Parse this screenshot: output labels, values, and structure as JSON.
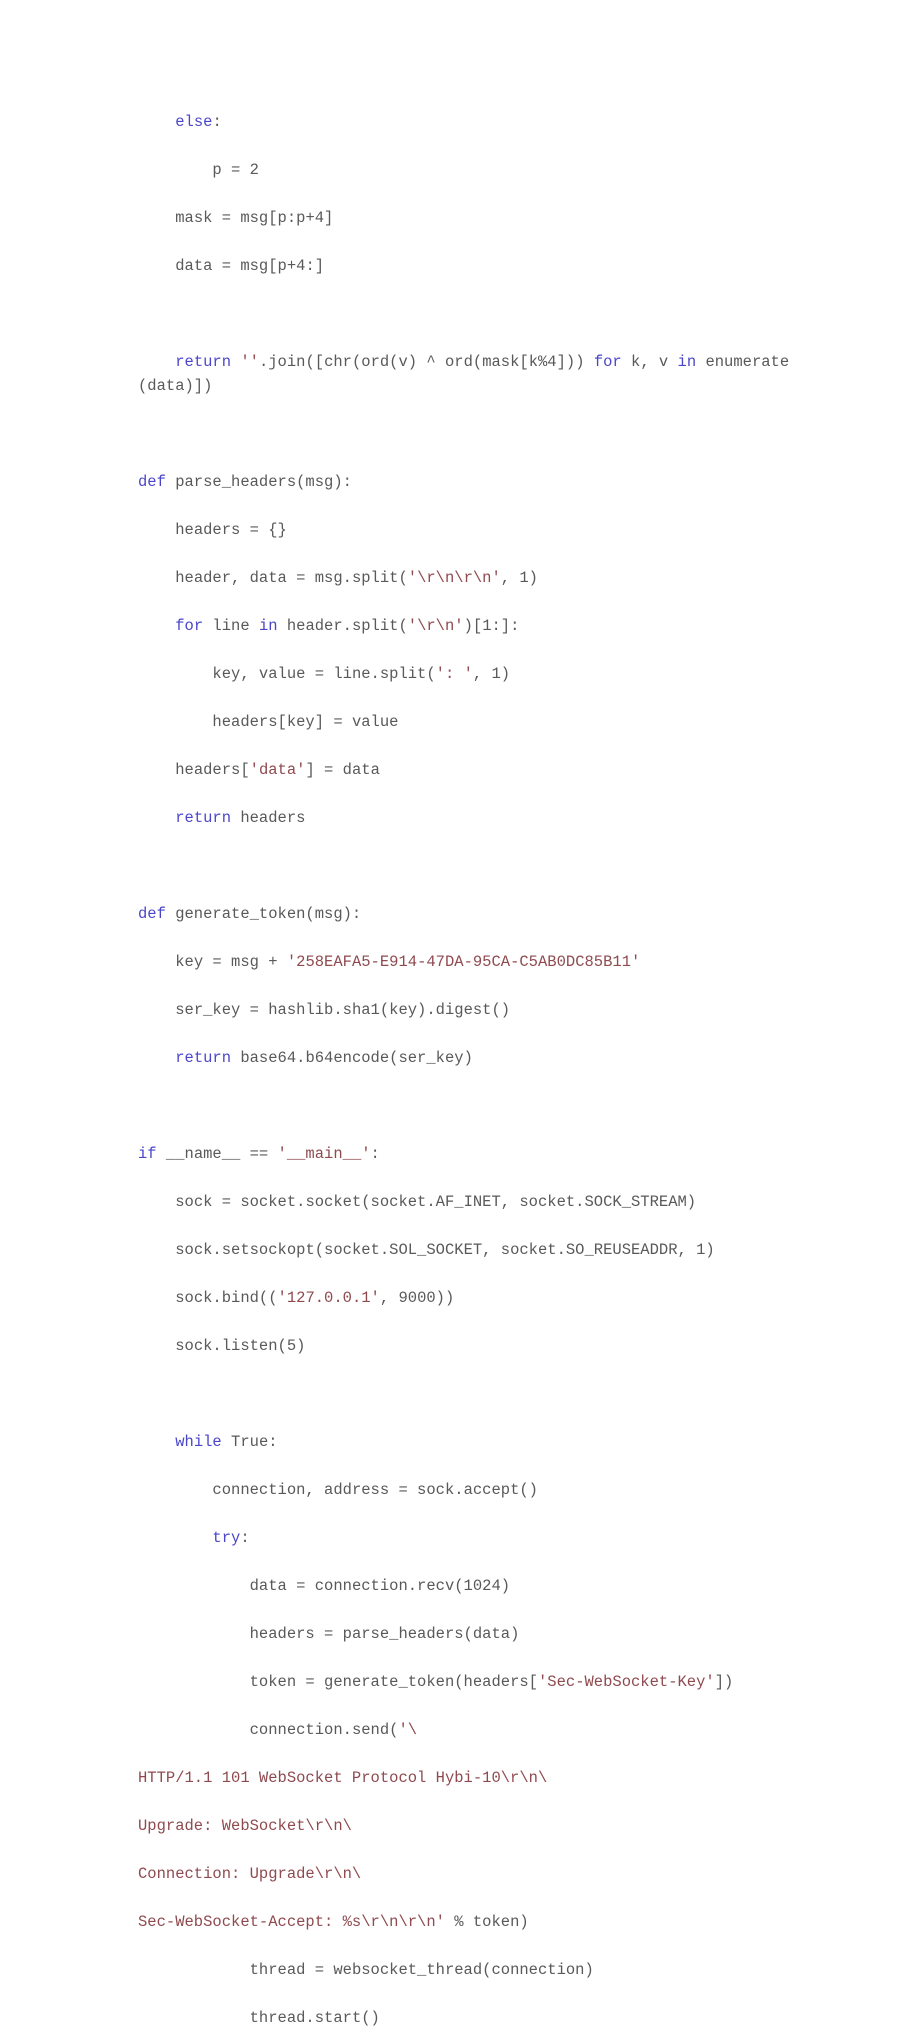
{
  "document": {
    "type": "code-listing",
    "language": "python",
    "page_background": "#ffffff",
    "colors": {
      "keyword": "#4b46c9",
      "string": "#8f4a4f",
      "identifier": "#595959"
    }
  },
  "code": {
    "lines": [
      {
        "indent": 4,
        "tokens": [
          {
            "t": "kw",
            "v": "else"
          },
          {
            "t": "id",
            "v": ":"
          }
        ]
      },
      {
        "indent": 8,
        "tokens": [
          {
            "t": "id",
            "v": "p = 2"
          }
        ]
      },
      {
        "indent": 4,
        "tokens": [
          {
            "t": "id",
            "v": "mask = msg[p:p+4]"
          }
        ]
      },
      {
        "indent": 4,
        "tokens": [
          {
            "t": "id",
            "v": "data = msg[p+4:]"
          }
        ]
      },
      {
        "indent": 0,
        "tokens": []
      },
      {
        "indent": 4,
        "tokens": [
          {
            "t": "kw",
            "v": "return"
          },
          {
            "t": "id",
            "v": " "
          },
          {
            "t": "str",
            "v": "''"
          },
          {
            "t": "id",
            "v": ".join([chr(ord(v) ^ ord(mask[k%4])) "
          },
          {
            "t": "kw",
            "v": "for"
          },
          {
            "t": "id",
            "v": " k, v "
          },
          {
            "t": "kw",
            "v": "in"
          },
          {
            "t": "id",
            "v": " enumerate(data)])"
          }
        ]
      },
      {
        "indent": 0,
        "tokens": []
      },
      {
        "indent": 0,
        "tokens": [
          {
            "t": "kw",
            "v": "def"
          },
          {
            "t": "id",
            "v": " parse_headers(msg):"
          }
        ]
      },
      {
        "indent": 4,
        "tokens": [
          {
            "t": "id",
            "v": "headers = {}"
          }
        ]
      },
      {
        "indent": 4,
        "tokens": [
          {
            "t": "id",
            "v": "header, data = msg.split("
          },
          {
            "t": "str",
            "v": "'\\r\\n\\r\\n'"
          },
          {
            "t": "id",
            "v": ", 1)"
          }
        ]
      },
      {
        "indent": 4,
        "tokens": [
          {
            "t": "kw",
            "v": "for"
          },
          {
            "t": "id",
            "v": " line "
          },
          {
            "t": "kw",
            "v": "in"
          },
          {
            "t": "id",
            "v": " header.split("
          },
          {
            "t": "str",
            "v": "'\\r\\n'"
          },
          {
            "t": "id",
            "v": ")[1:]:"
          }
        ]
      },
      {
        "indent": 8,
        "tokens": [
          {
            "t": "id",
            "v": "key, value = line.split("
          },
          {
            "t": "str",
            "v": "': '"
          },
          {
            "t": "id",
            "v": ", 1)"
          }
        ]
      },
      {
        "indent": 8,
        "tokens": [
          {
            "t": "id",
            "v": "headers[key] = value"
          }
        ]
      },
      {
        "indent": 4,
        "tokens": [
          {
            "t": "id",
            "v": "headers["
          },
          {
            "t": "str",
            "v": "'data'"
          },
          {
            "t": "id",
            "v": "] = data"
          }
        ]
      },
      {
        "indent": 4,
        "tokens": [
          {
            "t": "kw",
            "v": "return"
          },
          {
            "t": "id",
            "v": " headers"
          }
        ]
      },
      {
        "indent": 0,
        "tokens": []
      },
      {
        "indent": 0,
        "tokens": [
          {
            "t": "kw",
            "v": "def"
          },
          {
            "t": "id",
            "v": " generate_token(msg):"
          }
        ]
      },
      {
        "indent": 4,
        "tokens": [
          {
            "t": "id",
            "v": "key = msg + "
          },
          {
            "t": "str",
            "v": "'258EAFA5-E914-47DA-95CA-C5AB0DC85B11'"
          }
        ]
      },
      {
        "indent": 4,
        "tokens": [
          {
            "t": "id",
            "v": "ser_key = hashlib.sha1(key).digest()"
          }
        ]
      },
      {
        "indent": 4,
        "tokens": [
          {
            "t": "kw",
            "v": "return"
          },
          {
            "t": "id",
            "v": " base64.b64encode(ser_key)"
          }
        ]
      },
      {
        "indent": 0,
        "tokens": []
      },
      {
        "indent": 0,
        "tokens": [
          {
            "t": "kw",
            "v": "if"
          },
          {
            "t": "id",
            "v": " __name__ == "
          },
          {
            "t": "str",
            "v": "'__main__'"
          },
          {
            "t": "id",
            "v": ":"
          }
        ]
      },
      {
        "indent": 4,
        "tokens": [
          {
            "t": "id",
            "v": "sock = socket.socket(socket.AF_INET, socket.SOCK_STREAM)"
          }
        ]
      },
      {
        "indent": 4,
        "tokens": [
          {
            "t": "id",
            "v": "sock.setsockopt(socket.SOL_SOCKET, socket.SO_REUSEADDR, 1)"
          }
        ]
      },
      {
        "indent": 4,
        "tokens": [
          {
            "t": "id",
            "v": "sock.bind(("
          },
          {
            "t": "str",
            "v": "'127.0.0.1'"
          },
          {
            "t": "id",
            "v": ", 9000))"
          }
        ]
      },
      {
        "indent": 4,
        "tokens": [
          {
            "t": "id",
            "v": "sock.listen(5)"
          }
        ]
      },
      {
        "indent": 0,
        "tokens": []
      },
      {
        "indent": 4,
        "tokens": [
          {
            "t": "kw",
            "v": "while"
          },
          {
            "t": "id",
            "v": " True:"
          }
        ]
      },
      {
        "indent": 8,
        "tokens": [
          {
            "t": "id",
            "v": "connection, address = sock.accept()"
          }
        ]
      },
      {
        "indent": 8,
        "tokens": [
          {
            "t": "kw",
            "v": "try"
          },
          {
            "t": "id",
            "v": ":"
          }
        ]
      },
      {
        "indent": 12,
        "tokens": [
          {
            "t": "id",
            "v": "data = connection.recv(1024)"
          }
        ]
      },
      {
        "indent": 12,
        "tokens": [
          {
            "t": "id",
            "v": "headers = parse_headers(data)"
          }
        ]
      },
      {
        "indent": 12,
        "tokens": [
          {
            "t": "id",
            "v": "token = generate_token(headers["
          },
          {
            "t": "str",
            "v": "'Sec-WebSocket-Key'"
          },
          {
            "t": "id",
            "v": "])"
          }
        ]
      },
      {
        "indent": 12,
        "tokens": [
          {
            "t": "id",
            "v": "connection.send("
          },
          {
            "t": "str",
            "v": "'\\"
          }
        ]
      },
      {
        "indent": 0,
        "tokens": [
          {
            "t": "str",
            "v": "HTTP/1.1 101 WebSocket Protocol Hybi-10\\r\\n\\"
          }
        ]
      },
      {
        "indent": 0,
        "tokens": [
          {
            "t": "str",
            "v": "Upgrade: WebSocket\\r\\n\\"
          }
        ]
      },
      {
        "indent": 0,
        "tokens": [
          {
            "t": "str",
            "v": "Connection: Upgrade\\r\\n\\"
          }
        ]
      },
      {
        "indent": 0,
        "tokens": [
          {
            "t": "str",
            "v": "Sec-WebSocket-Accept: %s\\r\\n\\r\\n'"
          },
          {
            "t": "id",
            "v": " % token)"
          }
        ]
      },
      {
        "indent": 12,
        "tokens": [
          {
            "t": "id",
            "v": "thread = websocket_thread(connection)"
          }
        ]
      },
      {
        "indent": 12,
        "tokens": [
          {
            "t": "id",
            "v": "thread.start()"
          }
        ]
      }
    ]
  }
}
